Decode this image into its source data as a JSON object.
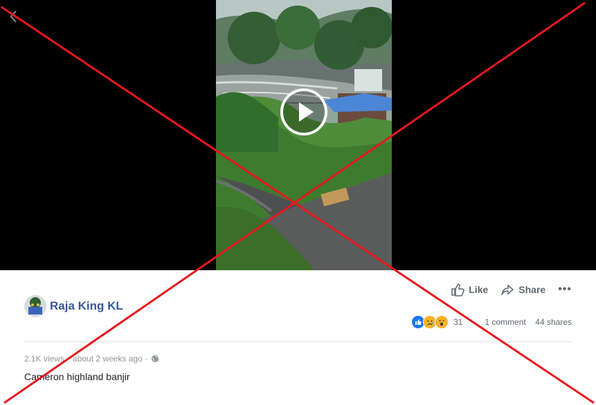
{
  "video": {
    "back_icon": "chevron-left-icon",
    "play_icon": "play-icon"
  },
  "post": {
    "author": "Raja King KL",
    "actions": {
      "like": "Like",
      "share": "Share",
      "more": "•••"
    },
    "stats": {
      "reaction_count": "31",
      "comments": "1 comment",
      "shares": "44 shares"
    },
    "meta": {
      "views": "2.1K views",
      "separator": "·",
      "time": "about 2 weeks ago",
      "separator2": "·"
    },
    "caption": "Cameron highland banjir"
  },
  "colors": {
    "author": "#385898",
    "overlay_x": "#e8171e",
    "like_reaction": "#1877f2",
    "sad_reaction": "#f7b125"
  }
}
